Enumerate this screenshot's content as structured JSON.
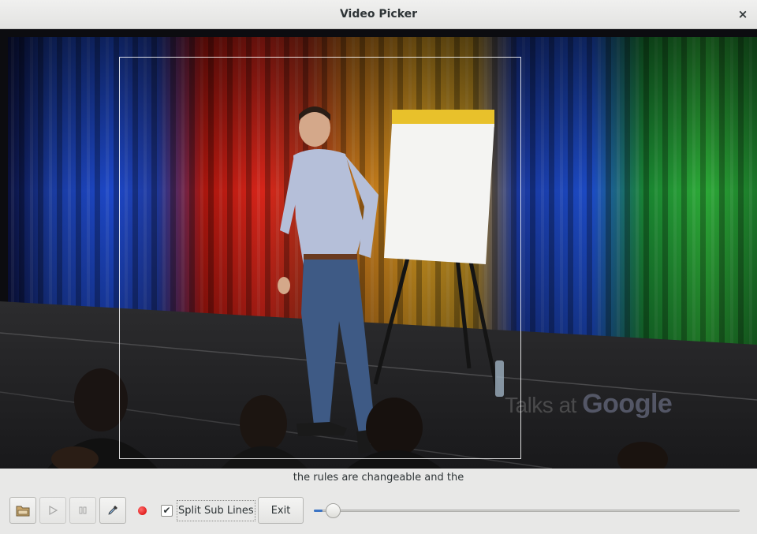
{
  "window": {
    "title": "Video Picker",
    "close_glyph": "×"
  },
  "video": {
    "watermark_prefix": "Talks at",
    "watermark_brand": "Google"
  },
  "subtitle": {
    "text": "the rules are changeable and the"
  },
  "controls": {
    "open_icon": "folder-icon",
    "play_icon": "play-icon",
    "pause_icon": "pause-icon",
    "picker_icon": "eyedropper-icon",
    "record_indicator_color": "#d40000",
    "split_sub_lines": {
      "label": "Split Sub Lines",
      "checked": true,
      "check_glyph": "✔"
    },
    "exit_label": "Exit",
    "seek_position": 0.02
  }
}
